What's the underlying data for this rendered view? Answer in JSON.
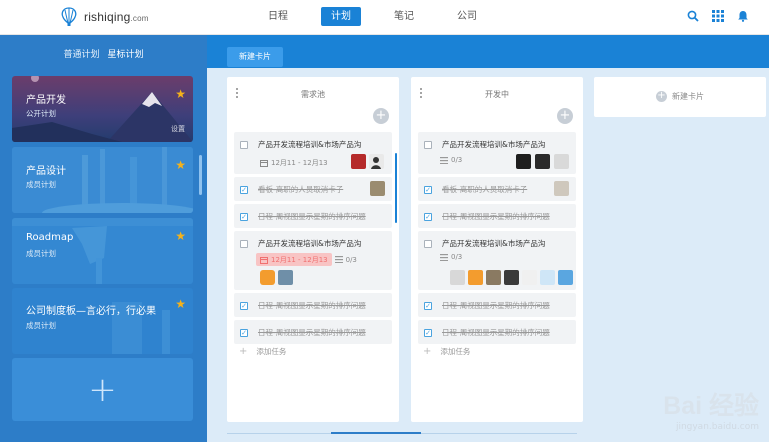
{
  "app": {
    "logo_text": "rishiqing",
    "logo_suffix": ".com"
  },
  "nav": {
    "items": [
      "日程",
      "计划",
      "笔记",
      "公司"
    ],
    "active_index": 1
  },
  "top_icons": [
    "search-icon",
    "apps-grid-icon",
    "bell-icon"
  ],
  "left_panel": {
    "tabs": [
      "普通计划",
      "星标计划"
    ],
    "active_tab": 1,
    "plans": [
      {
        "title": "产品开发",
        "subtitle": "公开计划",
        "badge": "设置",
        "starred": true
      },
      {
        "title": "产品设计",
        "subtitle": "成员计划",
        "starred": true
      },
      {
        "title": "Roadmap",
        "subtitle": "成员计划",
        "starred": true
      },
      {
        "title": "公司制度板—言必行，行必果",
        "subtitle": "成员计划",
        "starred": true
      }
    ],
    "add_label": "+"
  },
  "main": {
    "new_card_label": "新建卡片",
    "columns": [
      {
        "title": "需求池",
        "tasks": [
          {
            "title": "产品开发流程培训&市场产品沟",
            "done": false,
            "date": "12月11 - 12月13",
            "overdue": false
          },
          {
            "title": "看板-离职的人员取消卡子",
            "done": true
          },
          {
            "title": "日程-周视图显示星期的排序问题",
            "done": true
          },
          {
            "title": "产品开发流程培训&市场产品沟",
            "done": false,
            "date": "12月11 - 12月13",
            "overdue": true,
            "count": "0/3"
          },
          {
            "title": "日程-周视图显示星期的排序问题",
            "done": true
          },
          {
            "title": "日程-周视图显示星期的排序问题",
            "done": true
          }
        ],
        "add_task_label": "添加任务"
      },
      {
        "title": "开发中",
        "tasks": [
          {
            "title": "产品开发流程培训&市场产品沟",
            "done": false,
            "count": "0/3"
          },
          {
            "title": "看板-离职的人员取消卡子",
            "done": true
          },
          {
            "title": "日程-周视图显示星期的排序问题",
            "done": true
          },
          {
            "title": "产品开发流程培训&市场产品沟",
            "done": false,
            "count": "0/3"
          },
          {
            "title": "日程-周视图显示星期的排序问题",
            "done": true
          },
          {
            "title": "日程-周视图显示星期的排序问题",
            "done": true
          }
        ],
        "add_task_label": "添加任务"
      },
      {
        "title": "新建卡片"
      }
    ]
  },
  "watermark": {
    "brand": "Bai 经验",
    "url": "jingyan.baidu.com"
  },
  "colors": {
    "primary": "#1a82d6",
    "sidebar": "#2d7dc8",
    "star": "#f5b21a",
    "board_bg": "#dcebf8"
  }
}
